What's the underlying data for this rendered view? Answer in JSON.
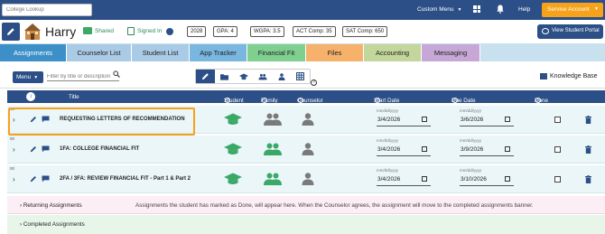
{
  "topbar": {
    "college_lookup_placeholder": "College Lookup",
    "custom_menu": "Custom Menu",
    "help": "Help",
    "service_account": "Service Account"
  },
  "student": {
    "name": "Harry",
    "shared": "Shared",
    "signed_in": "Signed In",
    "year": "2028",
    "gpa": "GPA: 4",
    "wgpa": "WGPA: 3.5",
    "act": "ACT Comp: 35",
    "sat": "SAT   Comp: 650",
    "view_portal": "View Student Portal"
  },
  "tabs": [
    {
      "label": "Assignments",
      "color": "#3d8fc8",
      "active": true
    },
    {
      "label": "Counselor List",
      "color": "#aacbe6"
    },
    {
      "label": "Student List",
      "color": "#aacbe6"
    },
    {
      "label": "App Tracker",
      "color": "#79b6e0"
    },
    {
      "label": "Financial Fit",
      "color": "#7fcf8f"
    },
    {
      "label": "Files",
      "color": "#f6b26b"
    },
    {
      "label": "Accounting",
      "color": "#c3d69b"
    },
    {
      "label": "Messaging",
      "color": "#c6a7d6"
    }
  ],
  "toolbar": {
    "menu": "Menu",
    "filter_placeholder": "Filter by title or description",
    "knowledge_base": "Knowledge Base"
  },
  "table": {
    "headers": {
      "title": "Title",
      "student": "Student",
      "family": "Family",
      "counselor": "Counselor",
      "start_date": "Start Date",
      "due_date": "Due Date",
      "done": "Done"
    },
    "date_format": "mm/dd/yyyy",
    "rows": [
      {
        "badge": "00",
        "title": "REQUESTING LETTERS OF RECOMMENDATION",
        "start": "3/4/2026",
        "due": "3/6/2026"
      },
      {
        "badge": "00",
        "title": "1FA: COLLEGE FINANCIAL FIT",
        "start": "3/4/2026",
        "due": "3/9/2026"
      },
      {
        "badge": "00",
        "title": "2FA / 3FA: REVIEW FINANCIAL FIT - Part 1 & Part 2",
        "start": "3/4/2026",
        "due": "3/10/2026"
      }
    ]
  },
  "sections": {
    "returning": "Returning Assignments",
    "returning_note": "Assignments the student has marked as Done, will appear here. When the Counselor agrees, the assignment will move to the completed assignments banner.",
    "completed": "Completed Assignments"
  },
  "colors": {
    "navy": "#2b4f86",
    "orange": "#f7a21b",
    "green": "#3aa867"
  }
}
